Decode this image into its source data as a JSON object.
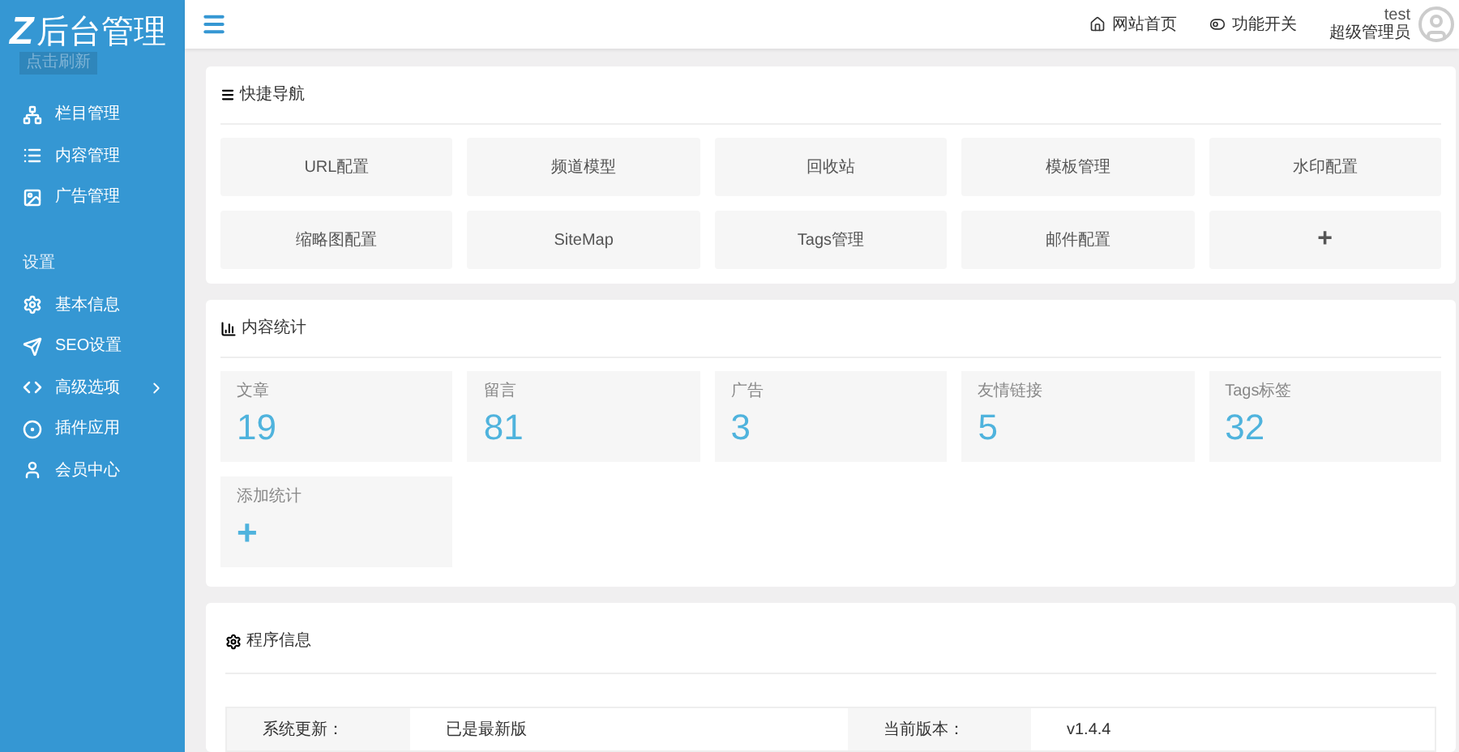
{
  "sidebar": {
    "logo_letter": "Z",
    "logo_text": "后台管理",
    "refresh_button": "点击刷新",
    "groups": [
      {
        "items": [
          {
            "kind": "sitemap",
            "label": "栏目管理",
            "has_submenu": false
          },
          {
            "kind": "list",
            "label": "内容管理",
            "has_submenu": false
          },
          {
            "kind": "image",
            "label": "广告管理",
            "has_submenu": false
          }
        ]
      },
      {
        "heading": "设置",
        "items": [
          {
            "kind": "gear",
            "label": "基本信息",
            "has_submenu": false
          },
          {
            "kind": "plane",
            "label": "SEO设置",
            "has_submenu": false
          },
          {
            "kind": "code",
            "label": "高级选项",
            "has_submenu": true
          },
          {
            "kind": "ball",
            "label": "插件应用",
            "has_submenu": false
          },
          {
            "kind": "user",
            "label": "会员中心",
            "has_submenu": false
          }
        ]
      }
    ]
  },
  "topbar": {
    "links": [
      {
        "kind": "home",
        "label": "网站首页"
      },
      {
        "kind": "toggle",
        "label": "功能开关"
      }
    ],
    "user": {
      "name": "test",
      "role": "超级管理员"
    }
  },
  "quick_nav": {
    "title": "快捷导航",
    "items": [
      {
        "label": "URL配置"
      },
      {
        "label": "频道模型"
      },
      {
        "label": "回收站"
      },
      {
        "label": "模板管理"
      },
      {
        "label": "水印配置"
      },
      {
        "label": "缩略图配置"
      },
      {
        "label": "SiteMap"
      },
      {
        "label": "Tags管理"
      },
      {
        "label": "邮件配置"
      },
      {
        "label": "+"
      }
    ]
  },
  "stats": {
    "title": "内容统计",
    "items": [
      {
        "kind": "count",
        "label": "文章",
        "value": "19"
      },
      {
        "kind": "count",
        "label": "留言",
        "value": "81"
      },
      {
        "kind": "count",
        "label": "广告",
        "value": "3"
      },
      {
        "kind": "count",
        "label": "友情链接",
        "value": "5"
      },
      {
        "kind": "count",
        "label": "Tags标签",
        "value": "32"
      },
      {
        "kind": "add",
        "label": "添加统计",
        "value": "+"
      }
    ]
  },
  "program_info": {
    "title": "程序信息",
    "rows": [
      {
        "cells": [
          "系统更新：",
          "已是最新版",
          "当前版本：",
          "v1.4.4"
        ]
      }
    ]
  }
}
